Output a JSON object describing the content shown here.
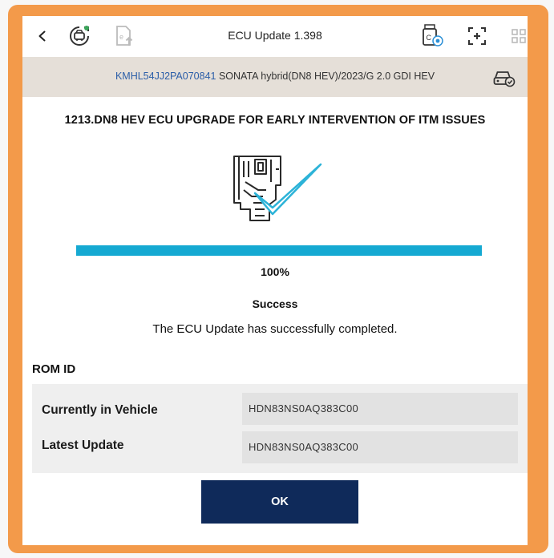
{
  "colors": {
    "frame": "#f39a4a",
    "accent_progress": "#15a9d2",
    "vehicle_bar": "#e5dfd8",
    "ok_button": "#0f2a5a",
    "vin_text": "#2b5ea8",
    "check_mark": "#2cb3d8"
  },
  "topbar": {
    "title": "ECU Update 1.398",
    "icons": [
      "back-arrow-icon",
      "vehicle-diagnostic-icon",
      "document-upload-icon",
      "usb-drive-icon",
      "screen-capture-icon",
      "grid-icon"
    ]
  },
  "vehicle": {
    "vin": "KMHL54JJ2PA070841",
    "description": "SONATA hybrid(DN8 HEV)/2023/G 2.0 GDI HEV",
    "icon": "vehicle-check-icon"
  },
  "heading": "1213.DN8 HEV ECU UPGRADE FOR EARLY INTERVENTION OF ITM ISSUES",
  "illustration_icon": "ecu-update-success-icon",
  "progress": {
    "value": 100,
    "label": "100%"
  },
  "status": {
    "title": "Success",
    "message": "The ECU Update has successfully completed."
  },
  "rom": {
    "title": "ROM ID",
    "rows": [
      {
        "label": "Currently in Vehicle",
        "value": "HDN83NS0AQ383C00"
      },
      {
        "label": "Latest Update",
        "value": "HDN83NS0AQ383C00"
      }
    ]
  },
  "ok_button": {
    "label": "OK"
  }
}
